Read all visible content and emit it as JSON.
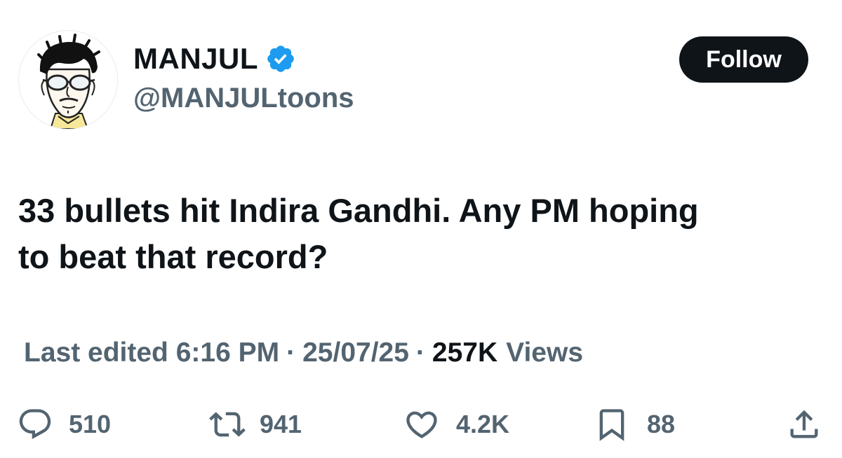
{
  "author": {
    "display_name": "MANJUL",
    "handle": "@MANJULtoons",
    "verified_icon": "verified-badge-icon",
    "avatar": "cartoon-self-portrait"
  },
  "follow_label": "Follow",
  "tweet": {
    "text": "33 bullets hit Indira Gandhi. Any PM hoping\nto beat that record?"
  },
  "meta": {
    "edited_label": "Last edited 6:16 PM",
    "separator": "·",
    "date": "25/07/25",
    "views_count": "257K",
    "views_label": "Views"
  },
  "actions": {
    "replies": "510",
    "reposts": "941",
    "likes": "4.2K",
    "bookmarks": "88"
  },
  "colors": {
    "text_primary": "#0f1419",
    "text_secondary": "#536471",
    "verified": "#1d9bf0",
    "follow_bg": "#0f1419"
  }
}
